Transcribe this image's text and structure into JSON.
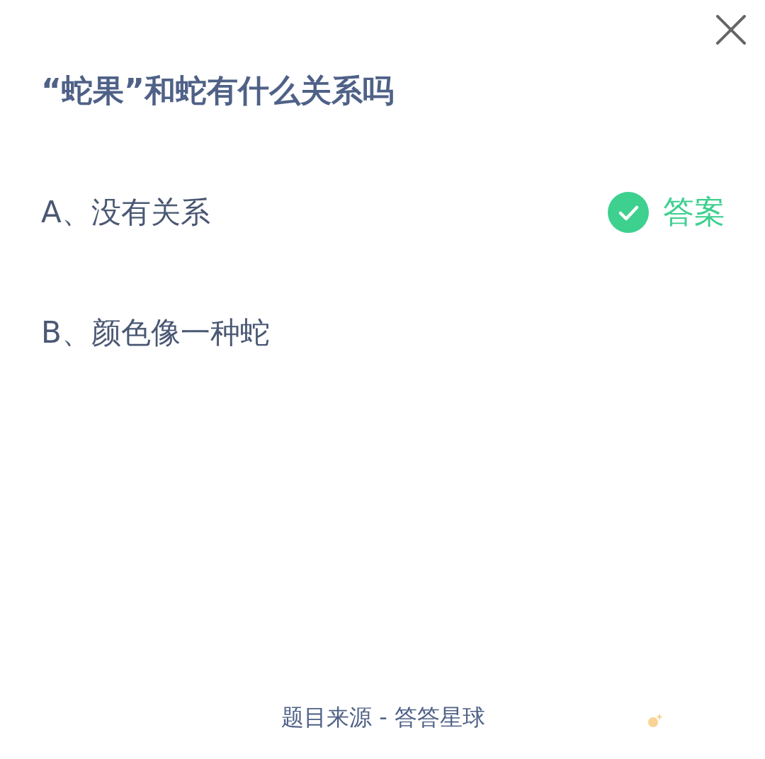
{
  "question": {
    "title": "“蛇果”和蛇有什么关系吗"
  },
  "options": [
    {
      "label": "A、没有关系",
      "correct": true,
      "answer_label": "答案"
    },
    {
      "label": "B、颜色像一种蛇",
      "correct": false
    }
  ],
  "footer": {
    "source": "题目来源 - 答答星球"
  }
}
